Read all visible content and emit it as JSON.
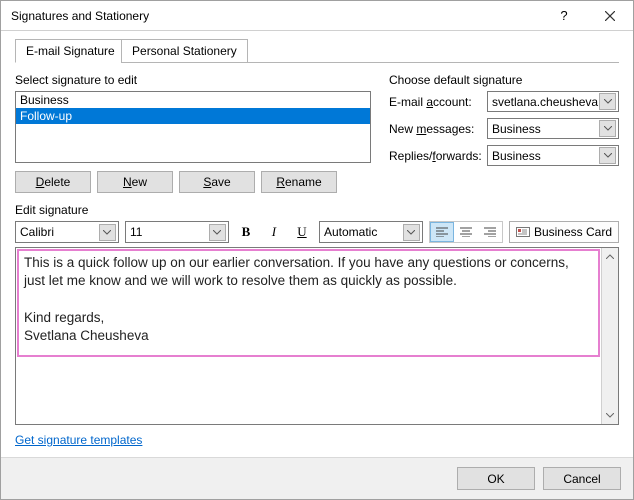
{
  "window": {
    "title": "Signatures and Stationery"
  },
  "tabs": {
    "email": "E-mail Signature",
    "stationery": "Personal Stationery"
  },
  "select_label": "Select signature to edit",
  "signatures": [
    "Business",
    "Follow-up"
  ],
  "buttons": {
    "delete": "Delete",
    "new": "New",
    "save": "Save",
    "rename": "Rename"
  },
  "defaults": {
    "group_label": "Choose default signature",
    "account_label": "E-mail account:",
    "account_value": "svetlana.cheusheva",
    "newmsg_label": "New messages:",
    "newmsg_value": "Business",
    "replies_label": "Replies/forwards:",
    "replies_value": "Business"
  },
  "edit_label": "Edit signature",
  "toolbar": {
    "font": "Calibri",
    "size": "11",
    "color": "Automatic",
    "business_card": "Business Card"
  },
  "editor": {
    "line1": "This is a quick follow up on our earlier conversation. If you have any questions or concerns, just let me know and we will work to resolve them as quickly as possible.",
    "line2": "Kind regards,",
    "line3": "Svetlana Cheusheva"
  },
  "link": "Get signature templates",
  "footer": {
    "ok": "OK",
    "cancel": "Cancel"
  }
}
